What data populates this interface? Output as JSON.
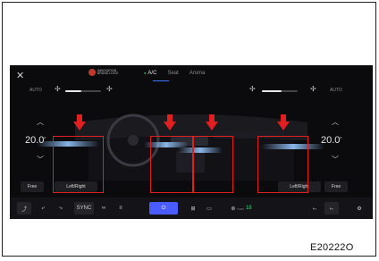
{
  "screen": {
    "close": "✕",
    "logo_text": "INNOVATION BRAND LOGO",
    "tabs": [
      {
        "label": "A/C",
        "active": true
      },
      {
        "label": "Seat",
        "active": false
      },
      {
        "label": "Aroma",
        "active": false
      }
    ],
    "fan_left": {
      "auto": "AUTO",
      "level": 0.45
    },
    "fan_right": {
      "auto": "AUTO",
      "level": 0.55
    },
    "temp_left": {
      "value": "20.0",
      "unit": "c"
    },
    "temp_right": {
      "value": "20.0",
      "unit": "c"
    },
    "left_modes": {
      "free": "Free",
      "leftright": "Left/Right"
    },
    "right_modes": {
      "leftright": "Left/Right",
      "free": "Free"
    },
    "bottom": {
      "sync": "SYNC",
      "level_label": "max",
      "level_value": "18"
    }
  },
  "figure_code": "E20222O",
  "colors": {
    "highlight": "#e02020",
    "accent": "#4b5cff",
    "active_tab_dot": "#3ad17a"
  }
}
